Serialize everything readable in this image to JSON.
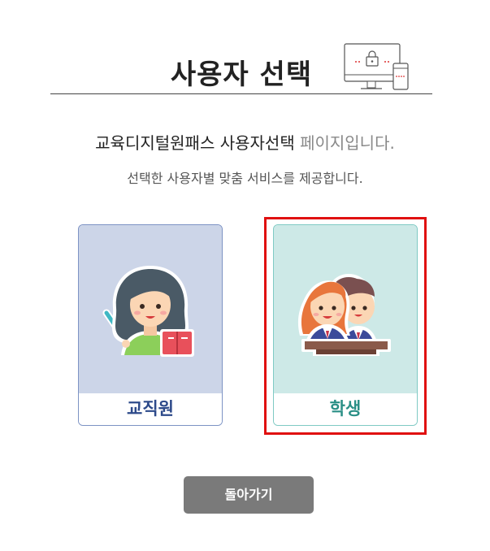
{
  "header": {
    "title": "사용자 선택",
    "icon": "devices-lock-icon"
  },
  "intro": {
    "line1_main": "교육디지털원패스 사용자선택",
    "line1_muted": "페이지입니다.",
    "line2": "선택한 사용자별 맞춤 서비스를 제공합니다."
  },
  "cards": {
    "staff": {
      "label": "교직원",
      "icon": "teacher-icon"
    },
    "student": {
      "label": "학생",
      "icon": "students-icon",
      "selected": true
    }
  },
  "footer": {
    "back_label": "돌아가기"
  },
  "colors": {
    "accent_red": "#e01010",
    "staff_bg": "#ccd5e8",
    "student_bg": "#cde9e7",
    "button_gray": "#7a7a7a"
  }
}
